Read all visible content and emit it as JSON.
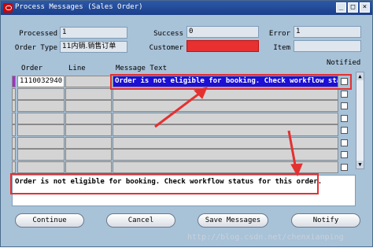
{
  "window": {
    "title": "Process Messages (Sales Order)"
  },
  "header": {
    "processed_label": "Processed",
    "processed_value": "1",
    "order_type_label": "Order Type",
    "order_type_value": "11内销.销售订单",
    "success_label": "Success",
    "success_value": "0",
    "customer_label": "Customer",
    "customer_value": "",
    "error_label": "Error",
    "error_value": "1",
    "item_label": "Item",
    "item_value": ""
  },
  "table": {
    "columns": {
      "order": "Order",
      "line": "Line",
      "message_text": "Message Text",
      "notified": "Notified"
    },
    "rows": [
      {
        "order": "1110032940",
        "line": "",
        "message": "Order is not eligible for booking. Check workflow status"
      },
      {
        "order": "",
        "line": "",
        "message": ""
      },
      {
        "order": "",
        "line": "",
        "message": ""
      },
      {
        "order": "",
        "line": "",
        "message": ""
      },
      {
        "order": "",
        "line": "",
        "message": ""
      },
      {
        "order": "",
        "line": "",
        "message": ""
      },
      {
        "order": "",
        "line": "",
        "message": ""
      },
      {
        "order": "",
        "line": "",
        "message": ""
      }
    ]
  },
  "message_detail": "Order is not eligible for booking. Check workflow status for this order.",
  "buttons": {
    "continue": "Continue",
    "cancel": "Cancel",
    "save_messages": "Save Messages",
    "notify": "Notify"
  },
  "watermark": "http://blog.csdn.net/chenxianping",
  "colors": {
    "title_bar": "#1b3f8a",
    "selection": "#1c0fd6",
    "annotation": "#e53030",
    "customer_field": "#e83030"
  }
}
